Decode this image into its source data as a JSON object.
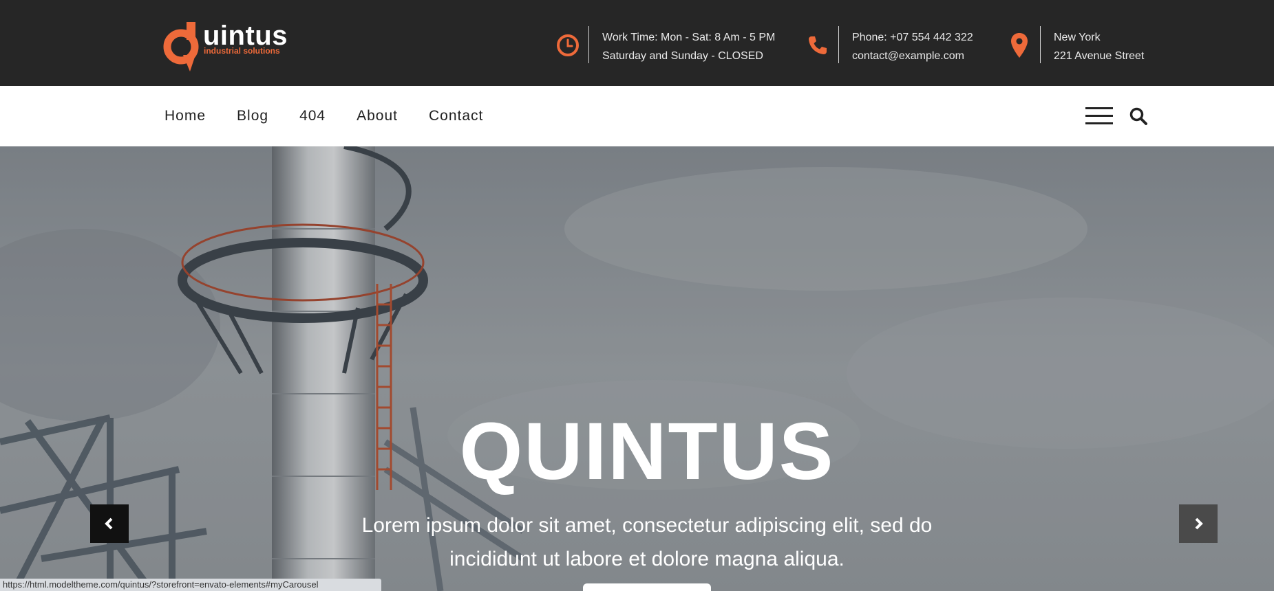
{
  "brand": {
    "name": "uintus",
    "tagline": "industrial solutions",
    "accent_color": "#ee6a3a",
    "dark_color": "#262626"
  },
  "header": {
    "worktime": {
      "icon": "clock-icon",
      "line1": "Work Time: Mon - Sat: 8 Am - 5 PM",
      "line2": "Saturday and Sunday - CLOSED"
    },
    "phone": {
      "icon": "phone-icon",
      "line1": "Phone: +07 554 442 322",
      "line2": "contact@example.com"
    },
    "location": {
      "icon": "map-pin-icon",
      "line1": "New York",
      "line2": "221 Avenue Street"
    }
  },
  "nav": {
    "items": [
      "Home",
      "Blog",
      "404",
      "About",
      "Contact"
    ],
    "menu_icon": "hamburger-icon",
    "search_icon": "search-icon"
  },
  "hero": {
    "title": "QUINTUS",
    "subtitle": "Lorem ipsum dolor sit amet, consectetur adipiscing elit, sed do incididunt ut labore et dolore magna aliqua.",
    "prev_icon": "chevron-left-icon",
    "next_icon": "chevron-right-icon"
  },
  "status_bar": {
    "url": "https://html.modeltheme.com/quintus/?storefront=envato-elements#myCarousel"
  }
}
